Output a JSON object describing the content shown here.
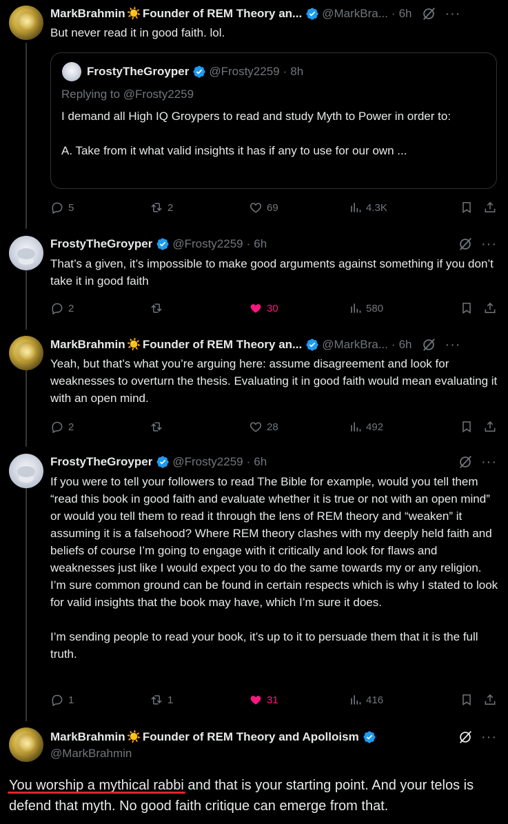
{
  "colors": {
    "accent": "#1d9bf0",
    "like": "#f91880",
    "muted": "#71767b",
    "underline": "#e0242c"
  },
  "tweets": [
    {
      "name": "MarkBrahmin",
      "badge_title": "Founder of REM Theory an...",
      "handle": "@MarkBra...",
      "time": "6h",
      "text": "But never read it in good faith. lol.",
      "quote": {
        "name": "FrostyTheGroyper",
        "handle": "@Frosty2259",
        "time": "8h",
        "replying": "Replying to @Frosty2259",
        "text_line1": "I demand all High IQ Groypers to read and study Myth to Power in order to:",
        "text_line2": "A. Take from it what valid insights it has if any to use for our own ..."
      },
      "replies": "5",
      "retweets": "2",
      "likes": "69",
      "views": "4.3K"
    },
    {
      "name": "FrostyTheGroyper",
      "handle": "@Frosty2259",
      "time": "6h",
      "text": "That’s a given, it’s impossible to make good arguments against something if you don’t take it in good faith",
      "replies": "2",
      "retweets": "",
      "likes": "30",
      "views": "580"
    },
    {
      "name": "MarkBrahmin",
      "badge_title": "Founder of REM Theory an...",
      "handle": "@MarkBra...",
      "time": "6h",
      "text": "Yeah, but that’s what you’re arguing here: assume disagreement and look for weaknesses to overturn the thesis. Evaluating it in good faith would mean evaluating it with an open mind.",
      "replies": "2",
      "retweets": "",
      "likes": "28",
      "views": "492"
    },
    {
      "name": "FrostyTheGroyper",
      "handle": "@Frosty2259",
      "time": "6h",
      "text_p1": "If you were to tell your followers to read The Bible for example, would you tell them “read this book in good faith and evaluate whether it is true or not with an open mind” or would you tell them to read it through the lens of REM theory and “weaken” it assuming it is a falsehood? Where REM theory clashes with my deeply held faith and beliefs of course I’m going to engage with it critically and look for flaws and weaknesses just like I would expect you to do the same towards my or any religion. I’m sure common ground can be found in certain respects which is why I stated to look for valid insights that the book may have, which I’m sure it does.",
      "text_p2": "I’m sending people to read your book, it’s up to it to persuade them that it is the full truth.",
      "replies": "1",
      "retweets": "1",
      "likes": "31",
      "views": "416"
    }
  ],
  "main": {
    "name": "MarkBrahmin",
    "badge_title": "Founder of REM Theory and Apolloism",
    "handle": "@MarkBrahmin",
    "text_underlined": "You worship a mythical rabbi",
    "text_rest": " and that is your starting point. And your telos is defend that myth. No good faith critique can emerge from that."
  }
}
